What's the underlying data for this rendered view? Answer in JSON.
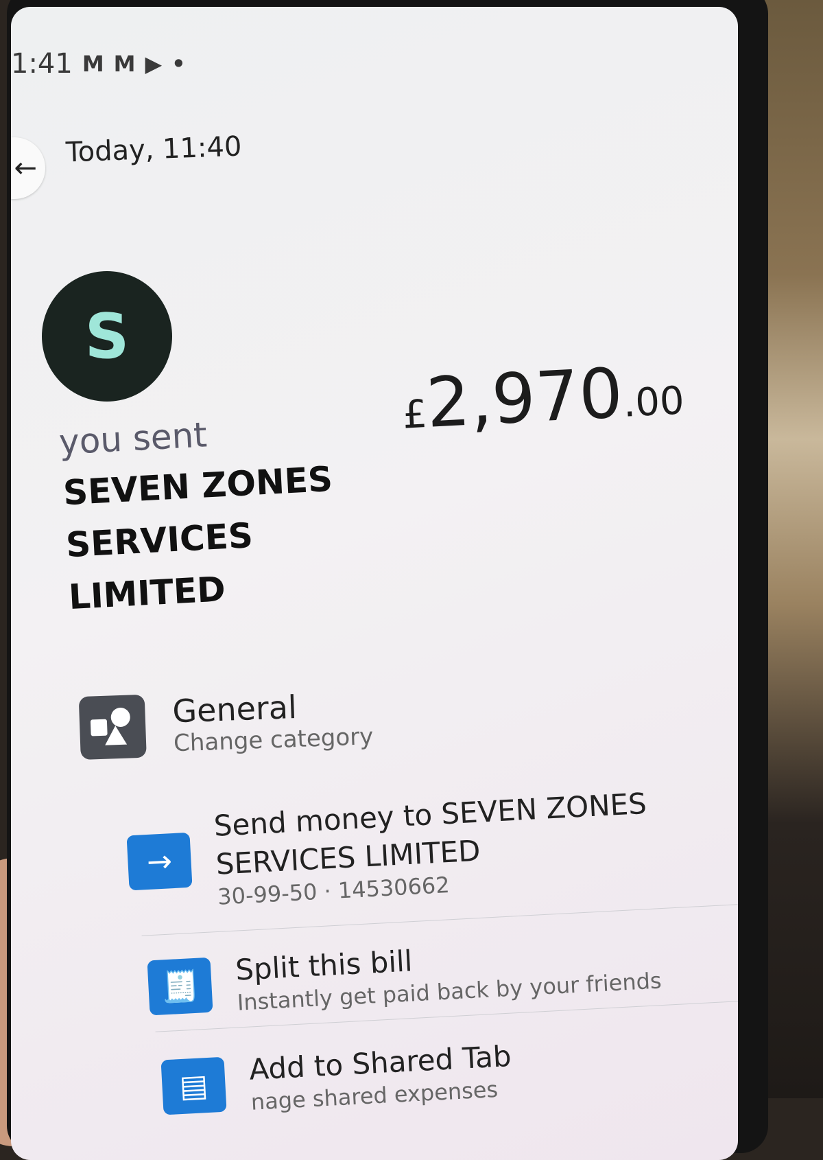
{
  "status_bar": {
    "time": "1:41",
    "icons": [
      "M",
      "M",
      "▶",
      "•"
    ]
  },
  "header": {
    "date": "Today, 11:40"
  },
  "transaction": {
    "avatar_letter": "S",
    "direction_label": "you sent",
    "payee_lines": [
      "SEVEN ZONES",
      "SERVICES",
      "LIMITED"
    ],
    "amount_currency": "£",
    "amount_integer": "2,970",
    "amount_decimal": ".00"
  },
  "category": {
    "title": "General",
    "subtitle": "Change category"
  },
  "actions": [
    {
      "icon": "arrow-right-icon",
      "title_line1": "Send money to SEVEN ZONES",
      "title_line2": "SERVICES LIMITED",
      "subtitle": "30-99-50 · 14530662"
    },
    {
      "icon": "receipt-split-icon",
      "title": "Split this bill",
      "subtitle": "Instantly get paid back by your friends"
    },
    {
      "icon": "shared-tab-icon",
      "title": "Add to Shared Tab",
      "subtitle": "nage shared expenses"
    }
  ],
  "colors": {
    "avatar_bg": "#1a2420",
    "avatar_fg": "#9fe6d9",
    "action_blue": "#1e7bd6",
    "category_icon_bg": "#4a4d54"
  }
}
